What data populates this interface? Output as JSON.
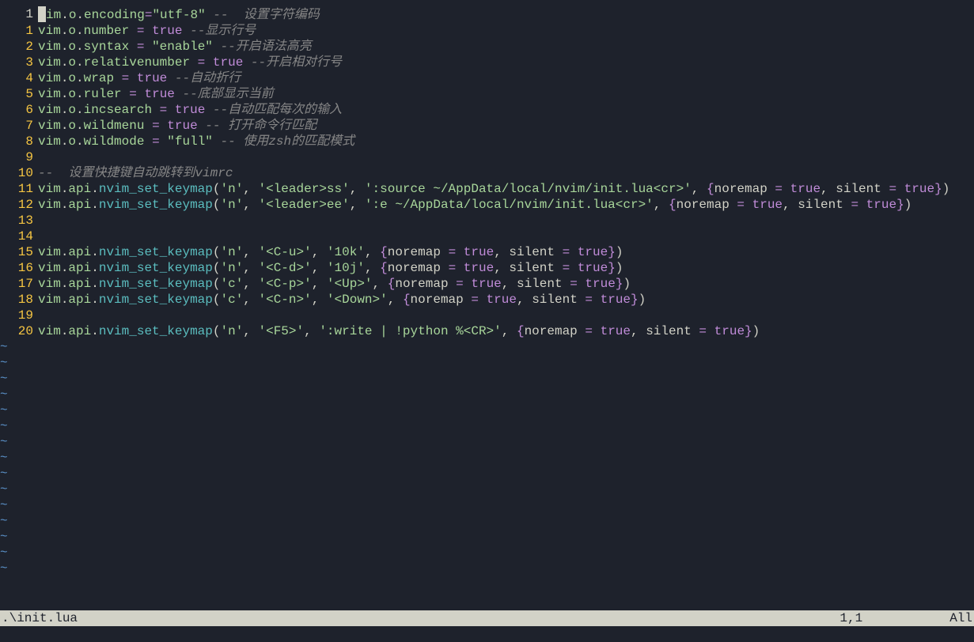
{
  "abs_line_number": "1",
  "tilde": "~",
  "statusline": {
    "filename": ".\\init.lua",
    "position": "1,1",
    "percent": "All"
  },
  "lines": {
    "l0": {
      "gutter": "1",
      "abs": true,
      "tokens": [
        {
          "t": "cursor"
        },
        {
          "c": "fn",
          "t": "im"
        },
        {
          "c": "punc",
          "t": "."
        },
        {
          "c": "fn",
          "t": "o"
        },
        {
          "c": "punc",
          "t": "."
        },
        {
          "c": "fn",
          "t": "encoding"
        },
        {
          "c": "op",
          "t": "="
        },
        {
          "c": "str",
          "t": "\"utf-8\""
        },
        {
          "c": "punc",
          "t": " "
        },
        {
          "c": "cmt",
          "t": "--  设置字符编码"
        }
      ]
    },
    "l1": {
      "gutter": "1",
      "tokens": [
        {
          "c": "fn",
          "t": "vim"
        },
        {
          "c": "punc",
          "t": "."
        },
        {
          "c": "fn",
          "t": "o"
        },
        {
          "c": "punc",
          "t": "."
        },
        {
          "c": "fn",
          "t": "number"
        },
        {
          "c": "punc",
          "t": " "
        },
        {
          "c": "op",
          "t": "="
        },
        {
          "c": "punc",
          "t": " "
        },
        {
          "c": "kw",
          "t": "true"
        },
        {
          "c": "punc",
          "t": " "
        },
        {
          "c": "cmt",
          "t": "--显示行号"
        }
      ]
    },
    "l2": {
      "gutter": "2",
      "tokens": [
        {
          "c": "fn",
          "t": "vim"
        },
        {
          "c": "punc",
          "t": "."
        },
        {
          "c": "fn",
          "t": "o"
        },
        {
          "c": "punc",
          "t": "."
        },
        {
          "c": "fn",
          "t": "syntax"
        },
        {
          "c": "punc",
          "t": " "
        },
        {
          "c": "op",
          "t": "="
        },
        {
          "c": "punc",
          "t": " "
        },
        {
          "c": "str",
          "t": "\"enable\""
        },
        {
          "c": "punc",
          "t": " "
        },
        {
          "c": "cmt",
          "t": "--开启语法高亮"
        }
      ]
    },
    "l3": {
      "gutter": "3",
      "tokens": [
        {
          "c": "fn",
          "t": "vim"
        },
        {
          "c": "punc",
          "t": "."
        },
        {
          "c": "fn",
          "t": "o"
        },
        {
          "c": "punc",
          "t": "."
        },
        {
          "c": "fn",
          "t": "relativenumber"
        },
        {
          "c": "punc",
          "t": " "
        },
        {
          "c": "op",
          "t": "="
        },
        {
          "c": "punc",
          "t": " "
        },
        {
          "c": "kw",
          "t": "true"
        },
        {
          "c": "punc",
          "t": " "
        },
        {
          "c": "cmt",
          "t": "--开启相对行号"
        }
      ]
    },
    "l4": {
      "gutter": "4",
      "tokens": [
        {
          "c": "fn",
          "t": "vim"
        },
        {
          "c": "punc",
          "t": "."
        },
        {
          "c": "fn",
          "t": "o"
        },
        {
          "c": "punc",
          "t": "."
        },
        {
          "c": "fn",
          "t": "wrap"
        },
        {
          "c": "punc",
          "t": " "
        },
        {
          "c": "op",
          "t": "="
        },
        {
          "c": "punc",
          "t": " "
        },
        {
          "c": "kw",
          "t": "true"
        },
        {
          "c": "punc",
          "t": " "
        },
        {
          "c": "cmt",
          "t": "--自动折行"
        }
      ]
    },
    "l5": {
      "gutter": "5",
      "tokens": [
        {
          "c": "fn",
          "t": "vim"
        },
        {
          "c": "punc",
          "t": "."
        },
        {
          "c": "fn",
          "t": "o"
        },
        {
          "c": "punc",
          "t": "."
        },
        {
          "c": "fn",
          "t": "ruler"
        },
        {
          "c": "punc",
          "t": " "
        },
        {
          "c": "op",
          "t": "="
        },
        {
          "c": "punc",
          "t": " "
        },
        {
          "c": "kw",
          "t": "true"
        },
        {
          "c": "punc",
          "t": " "
        },
        {
          "c": "cmt",
          "t": "--底部显示当前"
        }
      ]
    },
    "l6": {
      "gutter": "6",
      "tokens": [
        {
          "c": "fn",
          "t": "vim"
        },
        {
          "c": "punc",
          "t": "."
        },
        {
          "c": "fn",
          "t": "o"
        },
        {
          "c": "punc",
          "t": "."
        },
        {
          "c": "fn",
          "t": "incsearch"
        },
        {
          "c": "punc",
          "t": " "
        },
        {
          "c": "op",
          "t": "="
        },
        {
          "c": "punc",
          "t": " "
        },
        {
          "c": "kw",
          "t": "true"
        },
        {
          "c": "punc",
          "t": " "
        },
        {
          "c": "cmt",
          "t": "--自动匹配每次的输入"
        }
      ]
    },
    "l7": {
      "gutter": "7",
      "tokens": [
        {
          "c": "fn",
          "t": "vim"
        },
        {
          "c": "punc",
          "t": "."
        },
        {
          "c": "fn",
          "t": "o"
        },
        {
          "c": "punc",
          "t": "."
        },
        {
          "c": "fn",
          "t": "wildmenu"
        },
        {
          "c": "punc",
          "t": " "
        },
        {
          "c": "op",
          "t": "="
        },
        {
          "c": "punc",
          "t": " "
        },
        {
          "c": "kw",
          "t": "true"
        },
        {
          "c": "punc",
          "t": " "
        },
        {
          "c": "cmt",
          "t": "-- 打开命令行匹配"
        }
      ]
    },
    "l8": {
      "gutter": "8",
      "tokens": [
        {
          "c": "fn",
          "t": "vim"
        },
        {
          "c": "punc",
          "t": "."
        },
        {
          "c": "fn",
          "t": "o"
        },
        {
          "c": "punc",
          "t": "."
        },
        {
          "c": "fn",
          "t": "wildmode"
        },
        {
          "c": "punc",
          "t": " "
        },
        {
          "c": "op",
          "t": "="
        },
        {
          "c": "punc",
          "t": " "
        },
        {
          "c": "str",
          "t": "\"full\""
        },
        {
          "c": "punc",
          "t": " "
        },
        {
          "c": "cmt",
          "t": "-- 使用zsh的匹配模式"
        }
      ]
    },
    "l9": {
      "gutter": "9",
      "tokens": []
    },
    "l10": {
      "gutter": "10",
      "tokens": [
        {
          "c": "cmt",
          "t": "--  设置快捷键自动跳转到vimrc"
        }
      ]
    },
    "l11": {
      "gutter": "11",
      "tokens": [
        {
          "c": "fn",
          "t": "vim"
        },
        {
          "c": "punc",
          "t": "."
        },
        {
          "c": "fn",
          "t": "api"
        },
        {
          "c": "punc",
          "t": "."
        },
        {
          "c": "call",
          "t": "nvim_set_keymap"
        },
        {
          "c": "punc",
          "t": "("
        },
        {
          "c": "str",
          "t": "'n'"
        },
        {
          "c": "punc",
          "t": ", "
        },
        {
          "c": "str",
          "t": "'<leader>ss'"
        },
        {
          "c": "punc",
          "t": ", "
        },
        {
          "c": "str",
          "t": "':source ~/AppData/local/nvim/init.lua<cr>'"
        },
        {
          "c": "punc",
          "t": ", "
        },
        {
          "c": "brace",
          "t": "{"
        },
        {
          "c": "key",
          "t": "noremap "
        },
        {
          "c": "op",
          "t": "="
        },
        {
          "c": "punc",
          "t": " "
        },
        {
          "c": "kw",
          "t": "true"
        },
        {
          "c": "punc",
          "t": ", "
        },
        {
          "c": "key",
          "t": "silent "
        },
        {
          "c": "op",
          "t": "="
        },
        {
          "c": "punc",
          "t": " "
        },
        {
          "c": "kw",
          "t": "true"
        },
        {
          "c": "brace",
          "t": "}"
        },
        {
          "c": "punc",
          "t": ")"
        }
      ]
    },
    "l12": {
      "gutter": "12",
      "tokens": [
        {
          "c": "fn",
          "t": "vim"
        },
        {
          "c": "punc",
          "t": "."
        },
        {
          "c": "fn",
          "t": "api"
        },
        {
          "c": "punc",
          "t": "."
        },
        {
          "c": "call",
          "t": "nvim_set_keymap"
        },
        {
          "c": "punc",
          "t": "("
        },
        {
          "c": "str",
          "t": "'n'"
        },
        {
          "c": "punc",
          "t": ", "
        },
        {
          "c": "str",
          "t": "'<leader>ee'"
        },
        {
          "c": "punc",
          "t": ", "
        },
        {
          "c": "str",
          "t": "':e ~/AppData/local/nvim/init.lua<cr>'"
        },
        {
          "c": "punc",
          "t": ", "
        },
        {
          "c": "brace",
          "t": "{"
        },
        {
          "c": "key",
          "t": "noremap "
        },
        {
          "c": "op",
          "t": "="
        },
        {
          "c": "punc",
          "t": " "
        },
        {
          "c": "kw",
          "t": "true"
        },
        {
          "c": "punc",
          "t": ", "
        },
        {
          "c": "key",
          "t": "silent "
        },
        {
          "c": "op",
          "t": "="
        },
        {
          "c": "punc",
          "t": " "
        },
        {
          "c": "kw",
          "t": "true"
        },
        {
          "c": "brace",
          "t": "}"
        },
        {
          "c": "punc",
          "t": ")"
        }
      ]
    },
    "l13": {
      "gutter": "13",
      "tokens": []
    },
    "l14": {
      "gutter": "14",
      "tokens": []
    },
    "l15": {
      "gutter": "15",
      "tokens": [
        {
          "c": "fn",
          "t": "vim"
        },
        {
          "c": "punc",
          "t": "."
        },
        {
          "c": "fn",
          "t": "api"
        },
        {
          "c": "punc",
          "t": "."
        },
        {
          "c": "call",
          "t": "nvim_set_keymap"
        },
        {
          "c": "punc",
          "t": "("
        },
        {
          "c": "str",
          "t": "'n'"
        },
        {
          "c": "punc",
          "t": ", "
        },
        {
          "c": "str",
          "t": "'<C-u>'"
        },
        {
          "c": "punc",
          "t": ", "
        },
        {
          "c": "str",
          "t": "'10k'"
        },
        {
          "c": "punc",
          "t": ", "
        },
        {
          "c": "brace",
          "t": "{"
        },
        {
          "c": "key",
          "t": "noremap "
        },
        {
          "c": "op",
          "t": "="
        },
        {
          "c": "punc",
          "t": " "
        },
        {
          "c": "kw",
          "t": "true"
        },
        {
          "c": "punc",
          "t": ", "
        },
        {
          "c": "key",
          "t": "silent "
        },
        {
          "c": "op",
          "t": "="
        },
        {
          "c": "punc",
          "t": " "
        },
        {
          "c": "kw",
          "t": "true"
        },
        {
          "c": "brace",
          "t": "}"
        },
        {
          "c": "punc",
          "t": ")"
        }
      ]
    },
    "l16": {
      "gutter": "16",
      "tokens": [
        {
          "c": "fn",
          "t": "vim"
        },
        {
          "c": "punc",
          "t": "."
        },
        {
          "c": "fn",
          "t": "api"
        },
        {
          "c": "punc",
          "t": "."
        },
        {
          "c": "call",
          "t": "nvim_set_keymap"
        },
        {
          "c": "punc",
          "t": "("
        },
        {
          "c": "str",
          "t": "'n'"
        },
        {
          "c": "punc",
          "t": ", "
        },
        {
          "c": "str",
          "t": "'<C-d>'"
        },
        {
          "c": "punc",
          "t": ", "
        },
        {
          "c": "str",
          "t": "'10j'"
        },
        {
          "c": "punc",
          "t": ", "
        },
        {
          "c": "brace",
          "t": "{"
        },
        {
          "c": "key",
          "t": "noremap "
        },
        {
          "c": "op",
          "t": "="
        },
        {
          "c": "punc",
          "t": " "
        },
        {
          "c": "kw",
          "t": "true"
        },
        {
          "c": "punc",
          "t": ", "
        },
        {
          "c": "key",
          "t": "silent "
        },
        {
          "c": "op",
          "t": "="
        },
        {
          "c": "punc",
          "t": " "
        },
        {
          "c": "kw",
          "t": "true"
        },
        {
          "c": "brace",
          "t": "}"
        },
        {
          "c": "punc",
          "t": ")"
        }
      ]
    },
    "l17": {
      "gutter": "17",
      "tokens": [
        {
          "c": "fn",
          "t": "vim"
        },
        {
          "c": "punc",
          "t": "."
        },
        {
          "c": "fn",
          "t": "api"
        },
        {
          "c": "punc",
          "t": "."
        },
        {
          "c": "call",
          "t": "nvim_set_keymap"
        },
        {
          "c": "punc",
          "t": "("
        },
        {
          "c": "str",
          "t": "'c'"
        },
        {
          "c": "punc",
          "t": ", "
        },
        {
          "c": "str",
          "t": "'<C-p>'"
        },
        {
          "c": "punc",
          "t": ", "
        },
        {
          "c": "str",
          "t": "'<Up>'"
        },
        {
          "c": "punc",
          "t": ", "
        },
        {
          "c": "brace",
          "t": "{"
        },
        {
          "c": "key",
          "t": "noremap "
        },
        {
          "c": "op",
          "t": "="
        },
        {
          "c": "punc",
          "t": " "
        },
        {
          "c": "kw",
          "t": "true"
        },
        {
          "c": "punc",
          "t": ", "
        },
        {
          "c": "key",
          "t": "silent "
        },
        {
          "c": "op",
          "t": "="
        },
        {
          "c": "punc",
          "t": " "
        },
        {
          "c": "kw",
          "t": "true"
        },
        {
          "c": "brace",
          "t": "}"
        },
        {
          "c": "punc",
          "t": ")"
        }
      ]
    },
    "l18": {
      "gutter": "18",
      "tokens": [
        {
          "c": "fn",
          "t": "vim"
        },
        {
          "c": "punc",
          "t": "."
        },
        {
          "c": "fn",
          "t": "api"
        },
        {
          "c": "punc",
          "t": "."
        },
        {
          "c": "call",
          "t": "nvim_set_keymap"
        },
        {
          "c": "punc",
          "t": "("
        },
        {
          "c": "str",
          "t": "'c'"
        },
        {
          "c": "punc",
          "t": ", "
        },
        {
          "c": "str",
          "t": "'<C-n>'"
        },
        {
          "c": "punc",
          "t": ", "
        },
        {
          "c": "str",
          "t": "'<Down>'"
        },
        {
          "c": "punc",
          "t": ", "
        },
        {
          "c": "brace",
          "t": "{"
        },
        {
          "c": "key",
          "t": "noremap "
        },
        {
          "c": "op",
          "t": "="
        },
        {
          "c": "punc",
          "t": " "
        },
        {
          "c": "kw",
          "t": "true"
        },
        {
          "c": "punc",
          "t": ", "
        },
        {
          "c": "key",
          "t": "silent "
        },
        {
          "c": "op",
          "t": "="
        },
        {
          "c": "punc",
          "t": " "
        },
        {
          "c": "kw",
          "t": "true"
        },
        {
          "c": "brace",
          "t": "}"
        },
        {
          "c": "punc",
          "t": ")"
        }
      ]
    },
    "l19": {
      "gutter": "19",
      "tokens": []
    },
    "l20": {
      "gutter": "20",
      "tokens": [
        {
          "c": "fn",
          "t": "vim"
        },
        {
          "c": "punc",
          "t": "."
        },
        {
          "c": "fn",
          "t": "api"
        },
        {
          "c": "punc",
          "t": "."
        },
        {
          "c": "call",
          "t": "nvim_set_keymap"
        },
        {
          "c": "punc",
          "t": "("
        },
        {
          "c": "str",
          "t": "'n'"
        },
        {
          "c": "punc",
          "t": ", "
        },
        {
          "c": "str",
          "t": "'<F5>'"
        },
        {
          "c": "punc",
          "t": ", "
        },
        {
          "c": "str",
          "t": "':write | !python %<CR>'"
        },
        {
          "c": "punc",
          "t": ", "
        },
        {
          "c": "brace",
          "t": "{"
        },
        {
          "c": "key",
          "t": "noremap "
        },
        {
          "c": "op",
          "t": "="
        },
        {
          "c": "punc",
          "t": " "
        },
        {
          "c": "kw",
          "t": "true"
        },
        {
          "c": "punc",
          "t": ", "
        },
        {
          "c": "key",
          "t": "silent "
        },
        {
          "c": "op",
          "t": "="
        },
        {
          "c": "punc",
          "t": " "
        },
        {
          "c": "kw",
          "t": "true"
        },
        {
          "c": "brace",
          "t": "}"
        },
        {
          "c": "punc",
          "t": ")"
        }
      ]
    }
  },
  "tilde_count": 15
}
